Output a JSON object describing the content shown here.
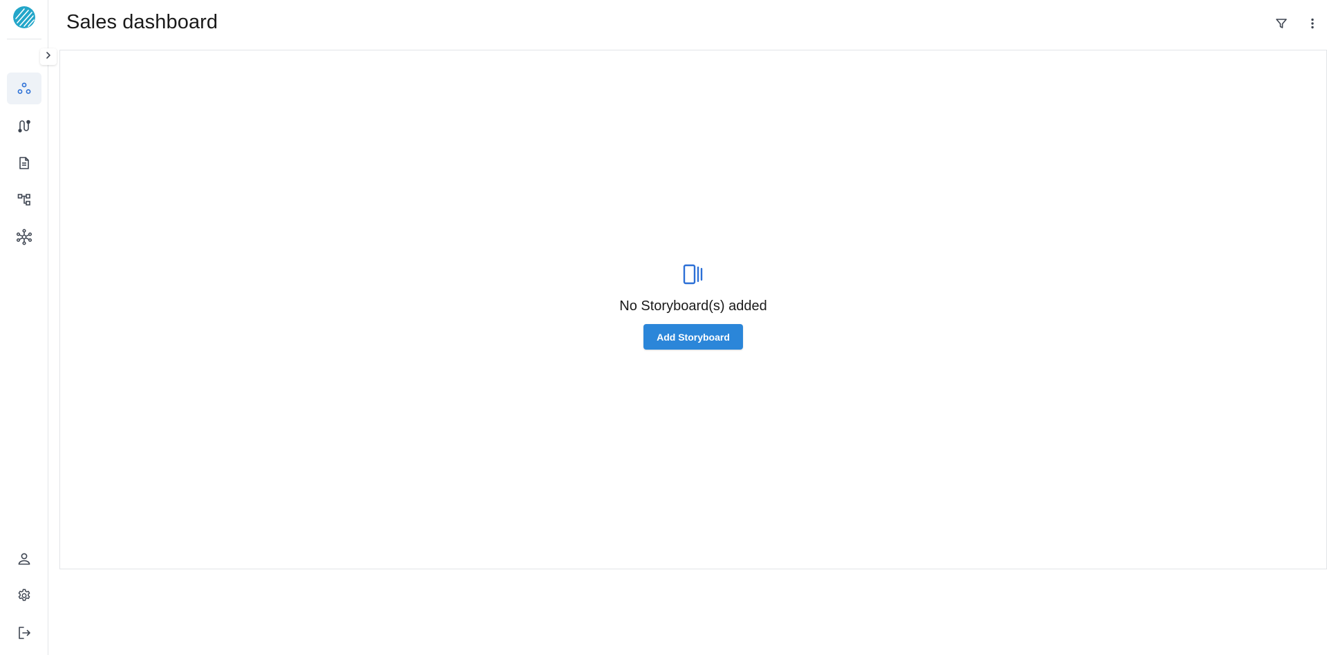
{
  "header": {
    "title": "Sales dashboard",
    "filter_icon": "filter-icon",
    "more_icon": "more-vertical-icon"
  },
  "sidebar": {
    "logo_icon": "app-logo-icon",
    "toggle_icon": "chevron-right-icon",
    "items": [
      {
        "icon": "nodes-icon",
        "active": true
      },
      {
        "icon": "route-icon",
        "active": false
      },
      {
        "icon": "document-icon",
        "active": false
      },
      {
        "icon": "hierarchy-icon",
        "active": false
      },
      {
        "icon": "network-hub-icon",
        "active": false
      }
    ],
    "bottom_items": [
      {
        "icon": "user-icon"
      },
      {
        "icon": "gear-icon"
      },
      {
        "icon": "logout-icon"
      }
    ]
  },
  "empty_state": {
    "icon": "storyboard-icon",
    "message": "No Storyboard(s) added",
    "button_label": "Add Storyboard"
  },
  "colors": {
    "accent": "#2b86d9",
    "icon": "#3d4450",
    "active_icon": "#2b6fd6",
    "active_bg": "#eef2f7",
    "border": "#e2e4e7"
  }
}
